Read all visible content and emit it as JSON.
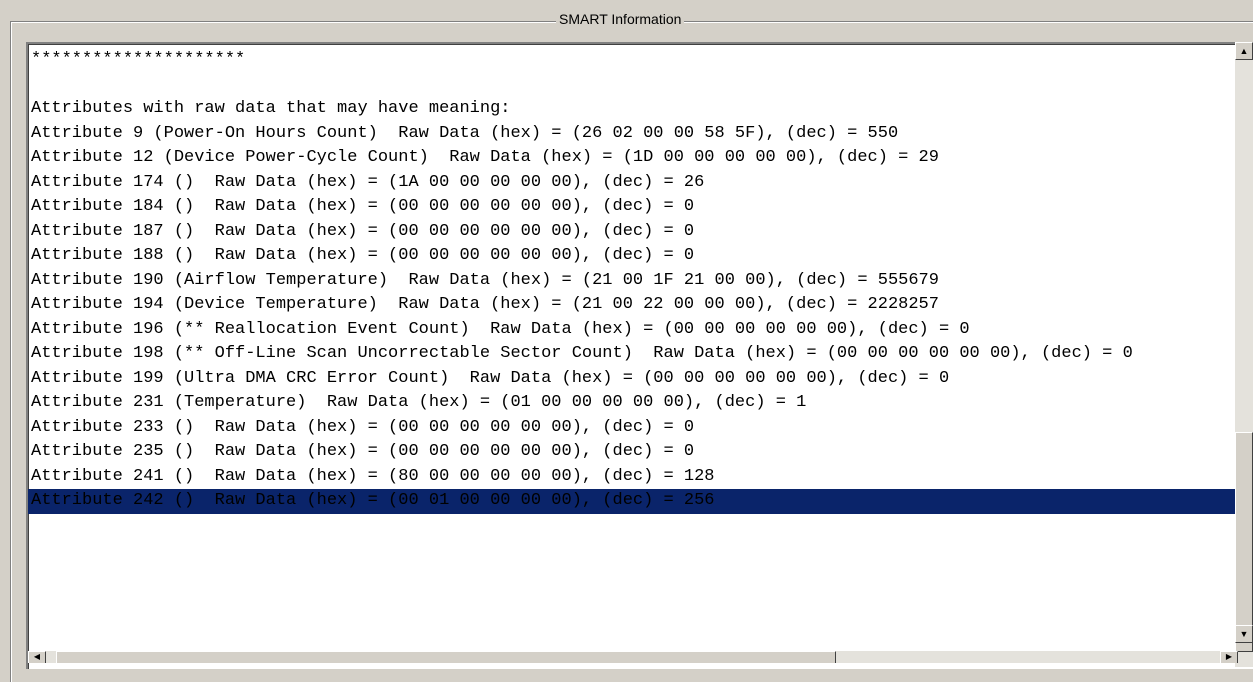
{
  "group": {
    "title": "SMART Information"
  },
  "textarea": {
    "lines": [
      "*********************",
      "",
      "Attributes with raw data that may have meaning:",
      "Attribute 9 (Power-On Hours Count)  Raw Data (hex) = (26 02 00 00 58 5F), (dec) = 550",
      "Attribute 12 (Device Power-Cycle Count)  Raw Data (hex) = (1D 00 00 00 00 00), (dec) = 29",
      "Attribute 174 ()  Raw Data (hex) = (1A 00 00 00 00 00), (dec) = 26",
      "Attribute 184 ()  Raw Data (hex) = (00 00 00 00 00 00), (dec) = 0",
      "Attribute 187 ()  Raw Data (hex) = (00 00 00 00 00 00), (dec) = 0",
      "Attribute 188 ()  Raw Data (hex) = (00 00 00 00 00 00), (dec) = 0",
      "Attribute 190 (Airflow Temperature)  Raw Data (hex) = (21 00 1F 21 00 00), (dec) = 555679",
      "Attribute 194 (Device Temperature)  Raw Data (hex) = (21 00 22 00 00 00), (dec) = 2228257",
      "Attribute 196 (** Reallocation Event Count)  Raw Data (hex) = (00 00 00 00 00 00), (dec) = 0",
      "Attribute 198 (** Off-Line Scan Uncorrectable Sector Count)  Raw Data (hex) = (00 00 00 00 00 00), (dec) = 0",
      "Attribute 199 (Ultra DMA CRC Error Count)  Raw Data (hex) = (00 00 00 00 00 00), (dec) = 0",
      "Attribute 231 (Temperature)  Raw Data (hex) = (01 00 00 00 00 00), (dec) = 1",
      "Attribute 233 ()  Raw Data (hex) = (00 00 00 00 00 00), (dec) = 0",
      "Attribute 235 ()  Raw Data (hex) = (00 00 00 00 00 00), (dec) = 0",
      "Attribute 241 ()  Raw Data (hex) = (80 00 00 00 00 00), (dec) = 128",
      "Attribute 242 ()  Raw Data (hex) = (00 01 00 00 00 00), (dec) = 256"
    ],
    "selected_line": 18
  },
  "scrollbar": {
    "up_glyph": "▲",
    "down_glyph": "▼",
    "left_glyph": "◀",
    "right_glyph": "▶"
  },
  "colors": {
    "selection": "#0a246a",
    "window_bg": "#d4d0c8",
    "text_bg": "#ffffff"
  }
}
